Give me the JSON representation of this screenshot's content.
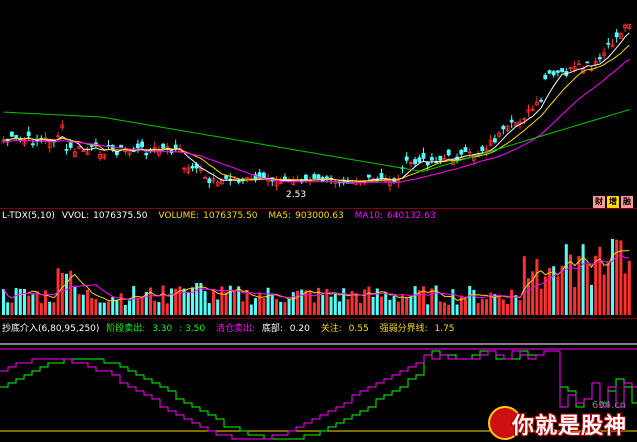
{
  "price_panel": {
    "low_label": "2.53",
    "period_buttons": [
      {
        "label": "财",
        "color": "#ff9a9a"
      },
      {
        "label": "增",
        "color": "#ffd700"
      },
      {
        "label": "融",
        "color": "#ff9a9a"
      }
    ]
  },
  "volume_panel": {
    "indicator": "L-TDX(5,10)",
    "vvol_label": "VVOL:",
    "vvol_value": "1076375.50",
    "volume_label": "VOLUME:",
    "volume_value": "1076375.50",
    "ma5_label": "MA5:",
    "ma5_value": "903000.63",
    "ma10_label": "MA10:",
    "ma10_value": "640132.63"
  },
  "indicator_panel": {
    "title": "抄底介入(6,80,95,250)",
    "stage_sell_label": "阶段卖出:",
    "stage_sell_value": "3.30",
    "stage_sell_value2": "3.50",
    "clear_sell_label": "清仓卖出:",
    "bottom_label": "底部:",
    "bottom_value": "0.20",
    "watch_label": "关注:",
    "watch_value": "0.55",
    "boundary_label": "强弱分界线:",
    "boundary_value": "1.75"
  },
  "watermark": {
    "text": "你就是股神",
    "site": "694.cn"
  },
  "colors": {
    "up": "#ff3030",
    "down": "#54ffff",
    "ma_white": "#ffffff",
    "ma_yellow": "#ffd700",
    "ma_magenta": "#ff00ff",
    "ma_green": "#00c800",
    "border": "#7a0000"
  }
}
